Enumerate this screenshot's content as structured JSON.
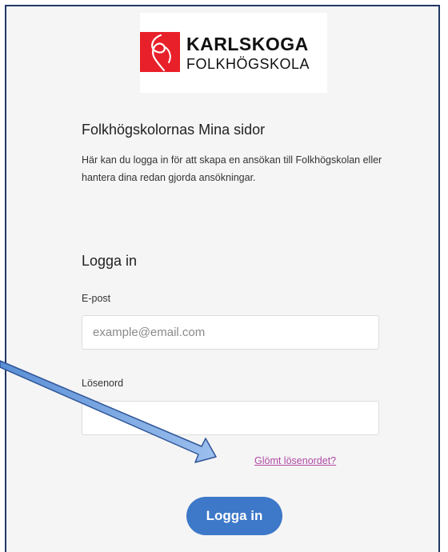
{
  "logo": {
    "line1": "KARLSKOGA",
    "line2": "FOLKHÖGSKOLA",
    "color": "#e8202a"
  },
  "page": {
    "title": "Folkhögskolornas Mina sidor",
    "intro": "Här kan du logga in för att skapa en ansökan till Folkhögskolan eller hantera dina redan gjorda ansökningar."
  },
  "login": {
    "heading": "Logga in",
    "email_label": "E-post",
    "email_placeholder": "example@email.com",
    "email_value": "",
    "password_label": "Lösenord",
    "password_value": "",
    "forgot_link": "Glömt lösenordet?",
    "submit_label": "Logga in"
  },
  "colors": {
    "button": "#3d78c9",
    "link": "#b04ba5",
    "frame": "#203864",
    "annotation_arrow": "#7aa6e0"
  }
}
